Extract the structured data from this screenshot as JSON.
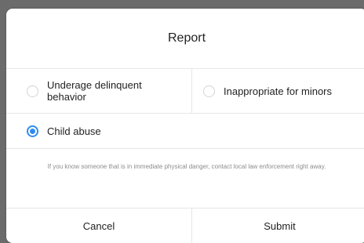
{
  "dialog": {
    "title": "Report",
    "options": [
      {
        "label": "Underage delinquent behavior",
        "checked": false
      },
      {
        "label": "Inappropriate for minors",
        "checked": false
      },
      {
        "label": "Child abuse",
        "checked": true
      }
    ],
    "notice": "If you know someone that is in immediate physical danger, contact local law enforcement right away.",
    "cancel_label": "Cancel",
    "submit_label": "Submit"
  },
  "colors": {
    "accent": "#2f8cf0",
    "backdrop": "#6b6b6b"
  }
}
